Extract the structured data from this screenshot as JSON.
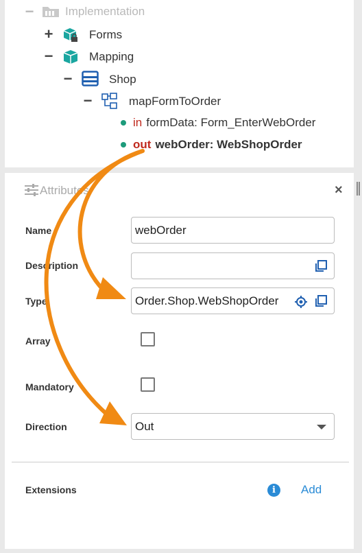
{
  "tree": {
    "implementation": "Implementation",
    "forms": "Forms",
    "mapping": "Mapping",
    "shop": "Shop",
    "method": "mapFormToOrder",
    "param_in": {
      "kw": "in",
      "text": "formData: Form_EnterWebOrder"
    },
    "param_out": {
      "kw": "out",
      "text": "webOrder: WebShopOrder"
    }
  },
  "panel": {
    "title": "Attributes",
    "close": "×",
    "fields": {
      "name": {
        "label": "Name",
        "value": "webOrder"
      },
      "description": {
        "label": "Description",
        "value": ""
      },
      "type": {
        "label": "Type",
        "value": "Order.Shop.WebShopOrder"
      },
      "array": {
        "label": "Array"
      },
      "mandatory": {
        "label": "Mandatory"
      },
      "direction": {
        "label": "Direction",
        "value": "Out"
      }
    },
    "extensions": {
      "label": "Extensions",
      "add": "Add"
    }
  },
  "colors": {
    "accent": "#f08a14",
    "teal": "#1aa6a0",
    "link": "#2a8bd6",
    "keyword": "#c0291d"
  }
}
